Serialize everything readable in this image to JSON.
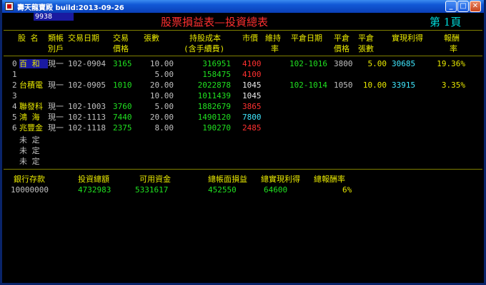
{
  "window": {
    "title": "壽天龍寶殿 build:2013-09-26",
    "minimize": "_",
    "maximize": "□",
    "close": "✕"
  },
  "header": {
    "code": "9938",
    "title": "股票損益表—投資總表",
    "page_prefix": "第",
    "page_number": "1",
    "page_suffix": "頁"
  },
  "columns": {
    "name": "股 名",
    "category_l1": "類帳",
    "category_l2": "別戶",
    "trade_date": "交易日期",
    "trade_price_l1": "交易",
    "trade_price_l2": "價格",
    "shares": "張數",
    "cost_l1": "持股成本",
    "cost_l2": "(含手續費)",
    "market_price": "市價",
    "hold_rate_l1": "維持",
    "hold_rate_l2": "率",
    "close_date": "平倉日期",
    "close_price_l1": "平倉",
    "close_price_l2": "價格",
    "close_shares_l1": "平倉",
    "close_shares_l2": "張數",
    "realized": "實現利得",
    "return_l1": "報酬",
    "return_l2": "率"
  },
  "rows": [
    {
      "idx": "0",
      "name": "百  和",
      "cat": "現一",
      "date": "102-0904",
      "price": "3165",
      "shares": "10.00",
      "cost": "316951",
      "market": "4100",
      "market_color": "red",
      "close_date": "102-1016",
      "close_price": "3800",
      "close_shares": "5.00",
      "realized": "30685",
      "ret": "19.36%",
      "name_hl": true
    },
    {
      "idx": "1",
      "name": "",
      "cat": "",
      "date": "",
      "price": "",
      "shares": "5.00",
      "cost": "158475",
      "market": "4100",
      "market_color": "red",
      "close_date": "",
      "close_price": "",
      "close_shares": "",
      "realized": "",
      "ret": ""
    },
    {
      "idx": "2",
      "name": "台積電",
      "cat": "現一",
      "date": "102-0905",
      "price": "1010",
      "shares": "20.00",
      "cost": "2022878",
      "market": "1045",
      "market_color": "white",
      "close_date": "102-1014",
      "close_price": "1050",
      "close_shares": "10.00",
      "realized": "33915",
      "ret": "3.35%"
    },
    {
      "idx": "3",
      "name": "",
      "cat": "",
      "date": "",
      "price": "",
      "shares": "10.00",
      "cost": "1011439",
      "market": "1045",
      "market_color": "white",
      "close_date": "",
      "close_price": "",
      "close_shares": "",
      "realized": "",
      "ret": ""
    },
    {
      "idx": "4",
      "name": "聯發科",
      "cat": "現一",
      "date": "102-1003",
      "price": "3760",
      "shares": "5.00",
      "cost": "1882679",
      "market": "3865",
      "market_color": "red",
      "close_date": "",
      "close_price": "",
      "close_shares": "",
      "realized": "",
      "ret": ""
    },
    {
      "idx": "5",
      "name": "鴻  海",
      "cat": "現一",
      "date": "102-1113",
      "price": "7440",
      "shares": "20.00",
      "cost": "1490120",
      "market": "7800",
      "market_color": "lightcyan",
      "close_date": "",
      "close_price": "",
      "close_shares": "",
      "realized": "",
      "ret": ""
    },
    {
      "idx": "6",
      "name": "兆豐金",
      "cat": "現一",
      "date": "102-1118",
      "price": "2375",
      "shares": "8.00",
      "cost": "190270",
      "market": "2485",
      "market_color": "red",
      "close_date": "",
      "close_price": "",
      "close_shares": "",
      "realized": "",
      "ret": ""
    }
  ],
  "undefined_rows": [
    "未  定",
    "未  定",
    "未  定"
  ],
  "summary": {
    "labels": {
      "bank": "銀行存款",
      "invest": "投資總額",
      "available": "可用資金",
      "book_pl": "總帳面損益",
      "realized": "總實現利得",
      "return": "總報酬率"
    },
    "values": {
      "bank": "10000000",
      "invest": "4732983",
      "available": "5331617",
      "book_pl": "452550",
      "realized": "64600",
      "return": "6%"
    }
  },
  "colors": {
    "background": "#000000",
    "header_text": "#00d8d8",
    "title_red": "#ff3030",
    "value_green": "#20e020",
    "name_yellow": "#e8e800"
  }
}
